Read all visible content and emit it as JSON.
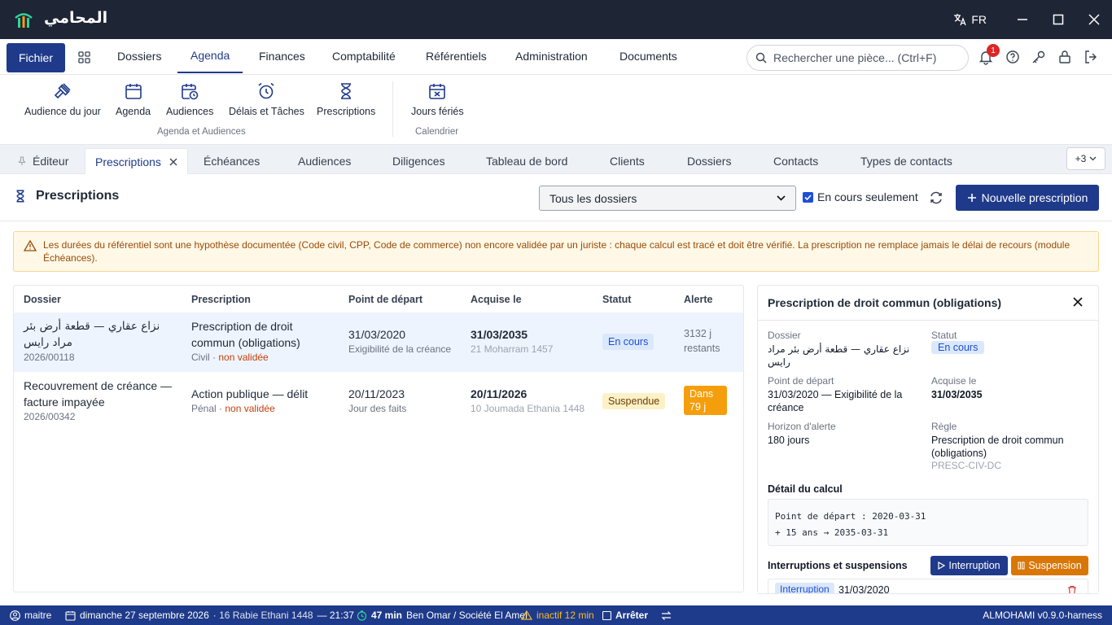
{
  "titlebar": {
    "app_name": "المحامي",
    "lang": "FR"
  },
  "menu": {
    "fichier": "Fichier",
    "items": [
      "Dossiers",
      "Agenda",
      "Finances",
      "Comptabilité",
      "Référentiels",
      "Administration",
      "Documents"
    ],
    "active": "Agenda",
    "search_placeholder": "Rechercher une pièce... (Ctrl+F)",
    "notif_count": "1"
  },
  "ribbon": {
    "buttons": [
      "Audience du jour",
      "Agenda",
      "Audiences",
      "Délais et Tâches",
      "Prescriptions",
      "Jours fériés"
    ],
    "groups": [
      "Agenda et Audiences",
      "Calendrier"
    ]
  },
  "tabs": {
    "items": [
      "Éditeur",
      "Prescriptions",
      "Échéances",
      "Audiences",
      "Diligences",
      "Tableau de bord",
      "Clients",
      "Dossiers",
      "Contacts",
      "Types de contacts"
    ],
    "more": "+3"
  },
  "page": {
    "title": "Prescriptions",
    "filter_value": "Tous les dossiers",
    "checkbox_label": "En cours seulement",
    "new_button": "Nouvelle prescription",
    "warning": "Les durées du référentiel sont une hypothèse documentée (Code civil, CPP, Code de commerce) non encore validée par un juriste : chaque calcul est tracé et doit être vérifié. La prescription ne remplace jamais le délai de recours (module Échéances)."
  },
  "table": {
    "headers": [
      "Dossier",
      "Prescription",
      "Point de départ",
      "Acquise le",
      "Statut",
      "Alerte"
    ],
    "rows": [
      {
        "dossier": "نزاع عقاري — قطعة أرض بئر مراد رايس",
        "dossier_num": "2026/00118",
        "prescription": "Prescription de droit commun (obligations)",
        "type": "Civil",
        "validation": "non validée",
        "depart": "31/03/2020",
        "depart_sub": "Exigibilité de la créance",
        "acquise": "31/03/2035",
        "acquise_hijri": "21 Moharram 1457",
        "statut": "En cours",
        "alerte": "3132 j restants"
      },
      {
        "dossier": "Recouvrement de créance — facture impayée",
        "dossier_num": "2026/00342",
        "prescription": "Action publique — délit",
        "type": "Pénal",
        "validation": "non validée",
        "depart": "20/11/2023",
        "depart_sub": "Jour des faits",
        "acquise": "20/11/2026",
        "acquise_hijri": "10 Joumada Ethania 1448",
        "statut": "Suspendue",
        "alerte": "Dans 79 j"
      }
    ]
  },
  "panel": {
    "title": "Prescription de droit commun (obligations)",
    "dossier_label": "Dossier",
    "dossier_value": "نزاع عقاري — قطعة أرض بئر مراد رايس",
    "statut_label": "Statut",
    "statut_value": "En cours",
    "depart_label": "Point de départ",
    "depart_value": "31/03/2020 — Exigibilité de la créance",
    "acquise_label": "Acquise le",
    "acquise_value": "31/03/2035",
    "horizon_label": "Horizon d'alerte",
    "horizon_value": "180 jours",
    "regle_label": "Règle",
    "regle_value": "Prescription de droit commun (obligations)",
    "regle_code": "PRESC-CIV-DC",
    "calc_label": "Détail du calcul",
    "calc_line1": "Point de départ : 2020-03-31",
    "calc_line2": "+ 15 ans → 2035-03-31",
    "interrupt_label": "Interruptions et suspensions",
    "btn_interruption": "Interruption",
    "btn_suspension": "Suspension",
    "entry_tag": "Interruption",
    "entry_date": "31/03/2020"
  },
  "statusbar": {
    "user": "maitre",
    "date": "dimanche 27 septembre 2026",
    "hijri": "· 16 Rabie Ethani 1448",
    "time": "— 21:37",
    "timer": "47 min",
    "client": "Ben Omar / Société El Amel",
    "inactive": "inactif 12 min",
    "stop": "Arrêter",
    "version": "ALMOHAMI v0.9.0-harness"
  }
}
